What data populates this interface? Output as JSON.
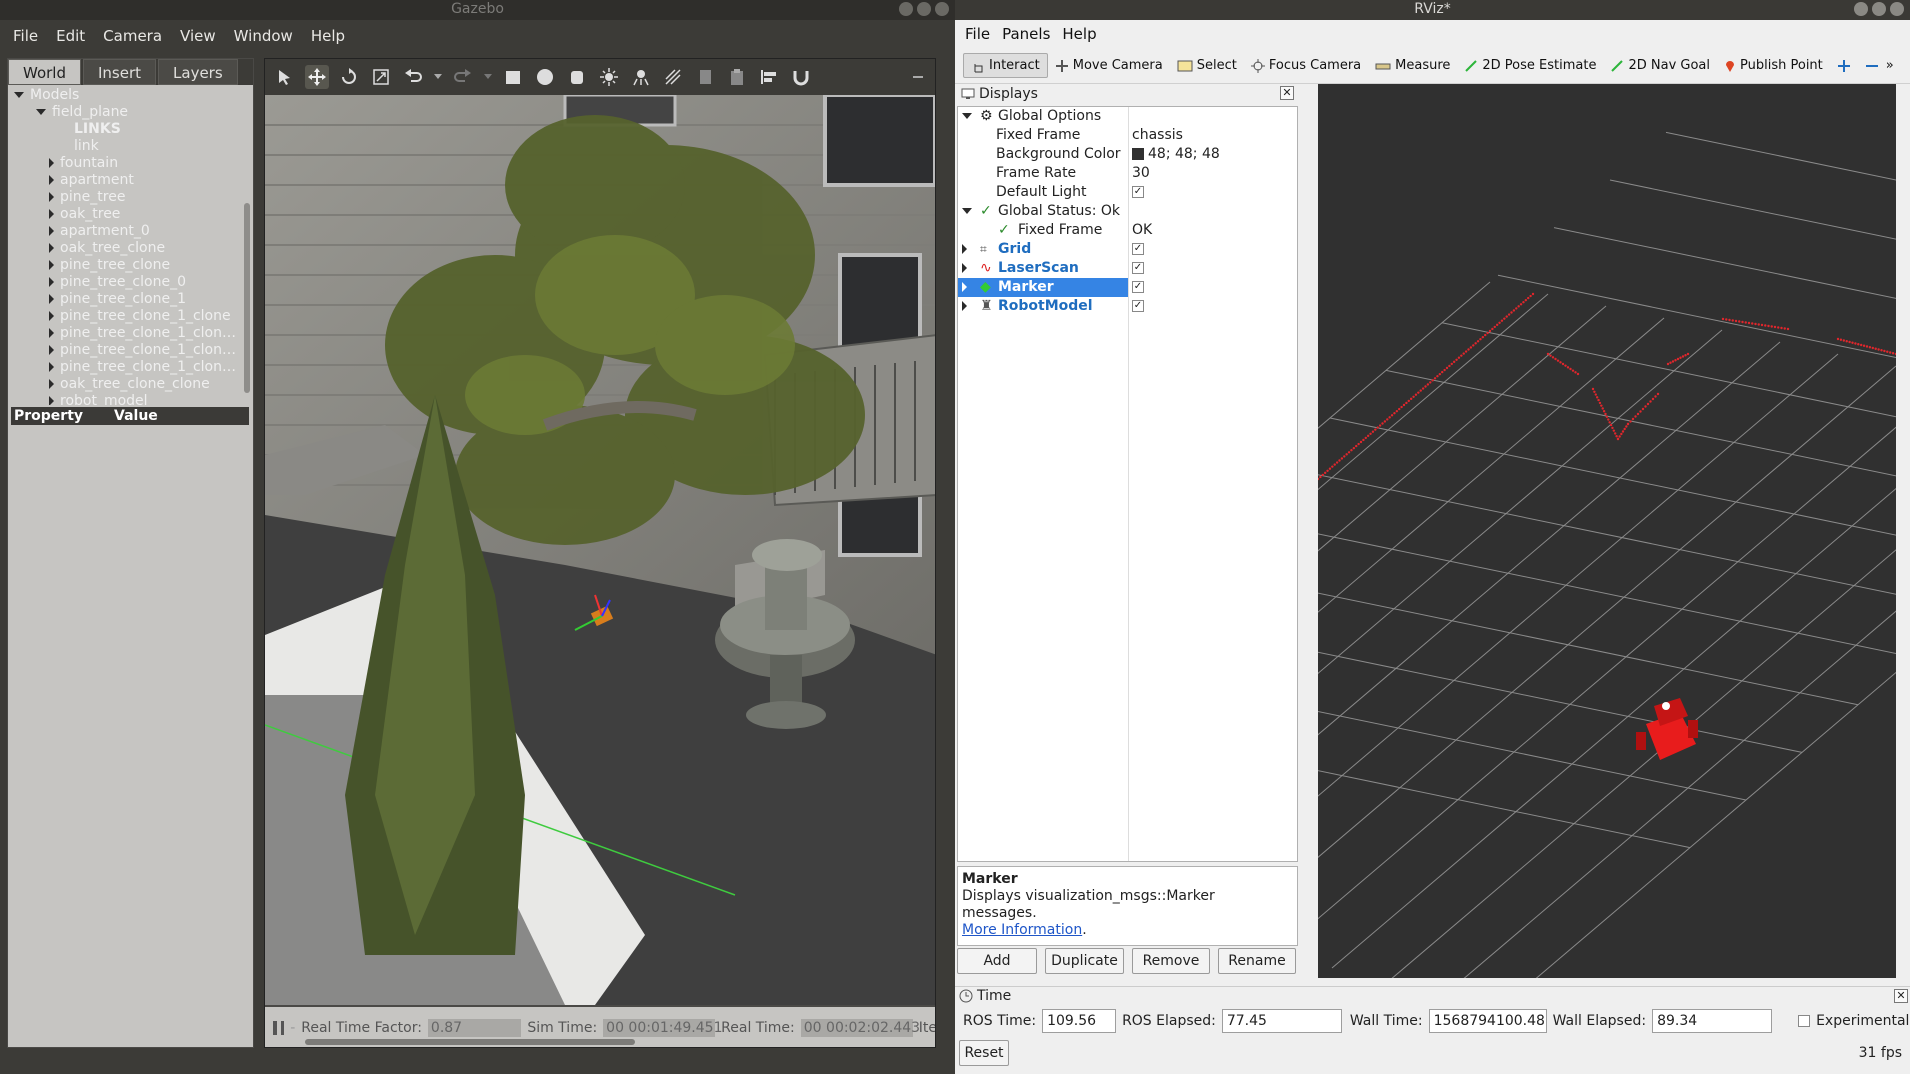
{
  "gazebo": {
    "title": "Gazebo",
    "menu": [
      "File",
      "Edit",
      "Camera",
      "View",
      "Window",
      "Help"
    ],
    "tabs": [
      "World",
      "Insert",
      "Layers"
    ],
    "tree": {
      "root": "Models",
      "expanded": "field_plane",
      "links_header": "LINKS",
      "link": "link",
      "items": [
        "fountain",
        "apartment",
        "pine_tree",
        "oak_tree",
        "apartment_0",
        "oak_tree_clone",
        "pine_tree_clone",
        "pine_tree_clone_0",
        "pine_tree_clone_1",
        "pine_tree_clone_1_clone",
        "pine_tree_clone_1_clon…",
        "pine_tree_clone_1_clon…",
        "pine_tree_clone_1_clon…",
        "oak_tree_clone_clone",
        "robot_model"
      ]
    },
    "property_header": {
      "property": "Property",
      "value": "Value"
    },
    "status": {
      "rtf_label": "Real Time Factor:",
      "rtf_value": "0.87",
      "sim_label": "Sim Time:",
      "sim_value": "00 00:01:49.451",
      "real_label": "Real Time:",
      "real_value": "00 00:02:02.443",
      "iter_label": "Ite"
    }
  },
  "rviz": {
    "title": "RViz*",
    "menu": [
      "File",
      "Panels",
      "Help"
    ],
    "toolbar": [
      "Interact",
      "Move Camera",
      "Select",
      "Focus Camera",
      "Measure",
      "2D Pose Estimate",
      "2D Nav Goal",
      "Publish Point"
    ],
    "displays_title": "Displays",
    "global_options": "Global Options",
    "fixed_frame_label": "Fixed Frame",
    "fixed_frame_value": "chassis",
    "bg_color_label": "Background Color",
    "bg_color_value": "48; 48; 48",
    "frame_rate_label": "Frame Rate",
    "frame_rate_value": "30",
    "default_light_label": "Default Light",
    "global_status": "Global Status: Ok",
    "status_fixed_frame": "Fixed Frame",
    "status_fixed_frame_value": "OK",
    "displays": [
      "Grid",
      "LaserScan",
      "Marker",
      "RobotModel"
    ],
    "desc_title": "Marker",
    "desc_text": "Displays visualization_msgs::Marker messages.",
    "desc_link": "More Information",
    "buttons": [
      "Add",
      "Duplicate",
      "Remove",
      "Rename"
    ],
    "time_title": "Time",
    "ros_time_label": "ROS Time:",
    "ros_time": "109.56",
    "ros_elapsed_label": "ROS Elapsed:",
    "ros_elapsed": "77.45",
    "wall_time_label": "Wall Time:",
    "wall_time": "1568794100.48",
    "wall_elapsed_label": "Wall Elapsed:",
    "wall_elapsed": "89.34",
    "experimental": "Experimental",
    "reset": "Reset",
    "fps": "31 fps",
    "colors": {
      "selection": "#3584e4",
      "laser": "#e0262c",
      "robot": "#e81c1c",
      "bg": "#303030"
    }
  }
}
